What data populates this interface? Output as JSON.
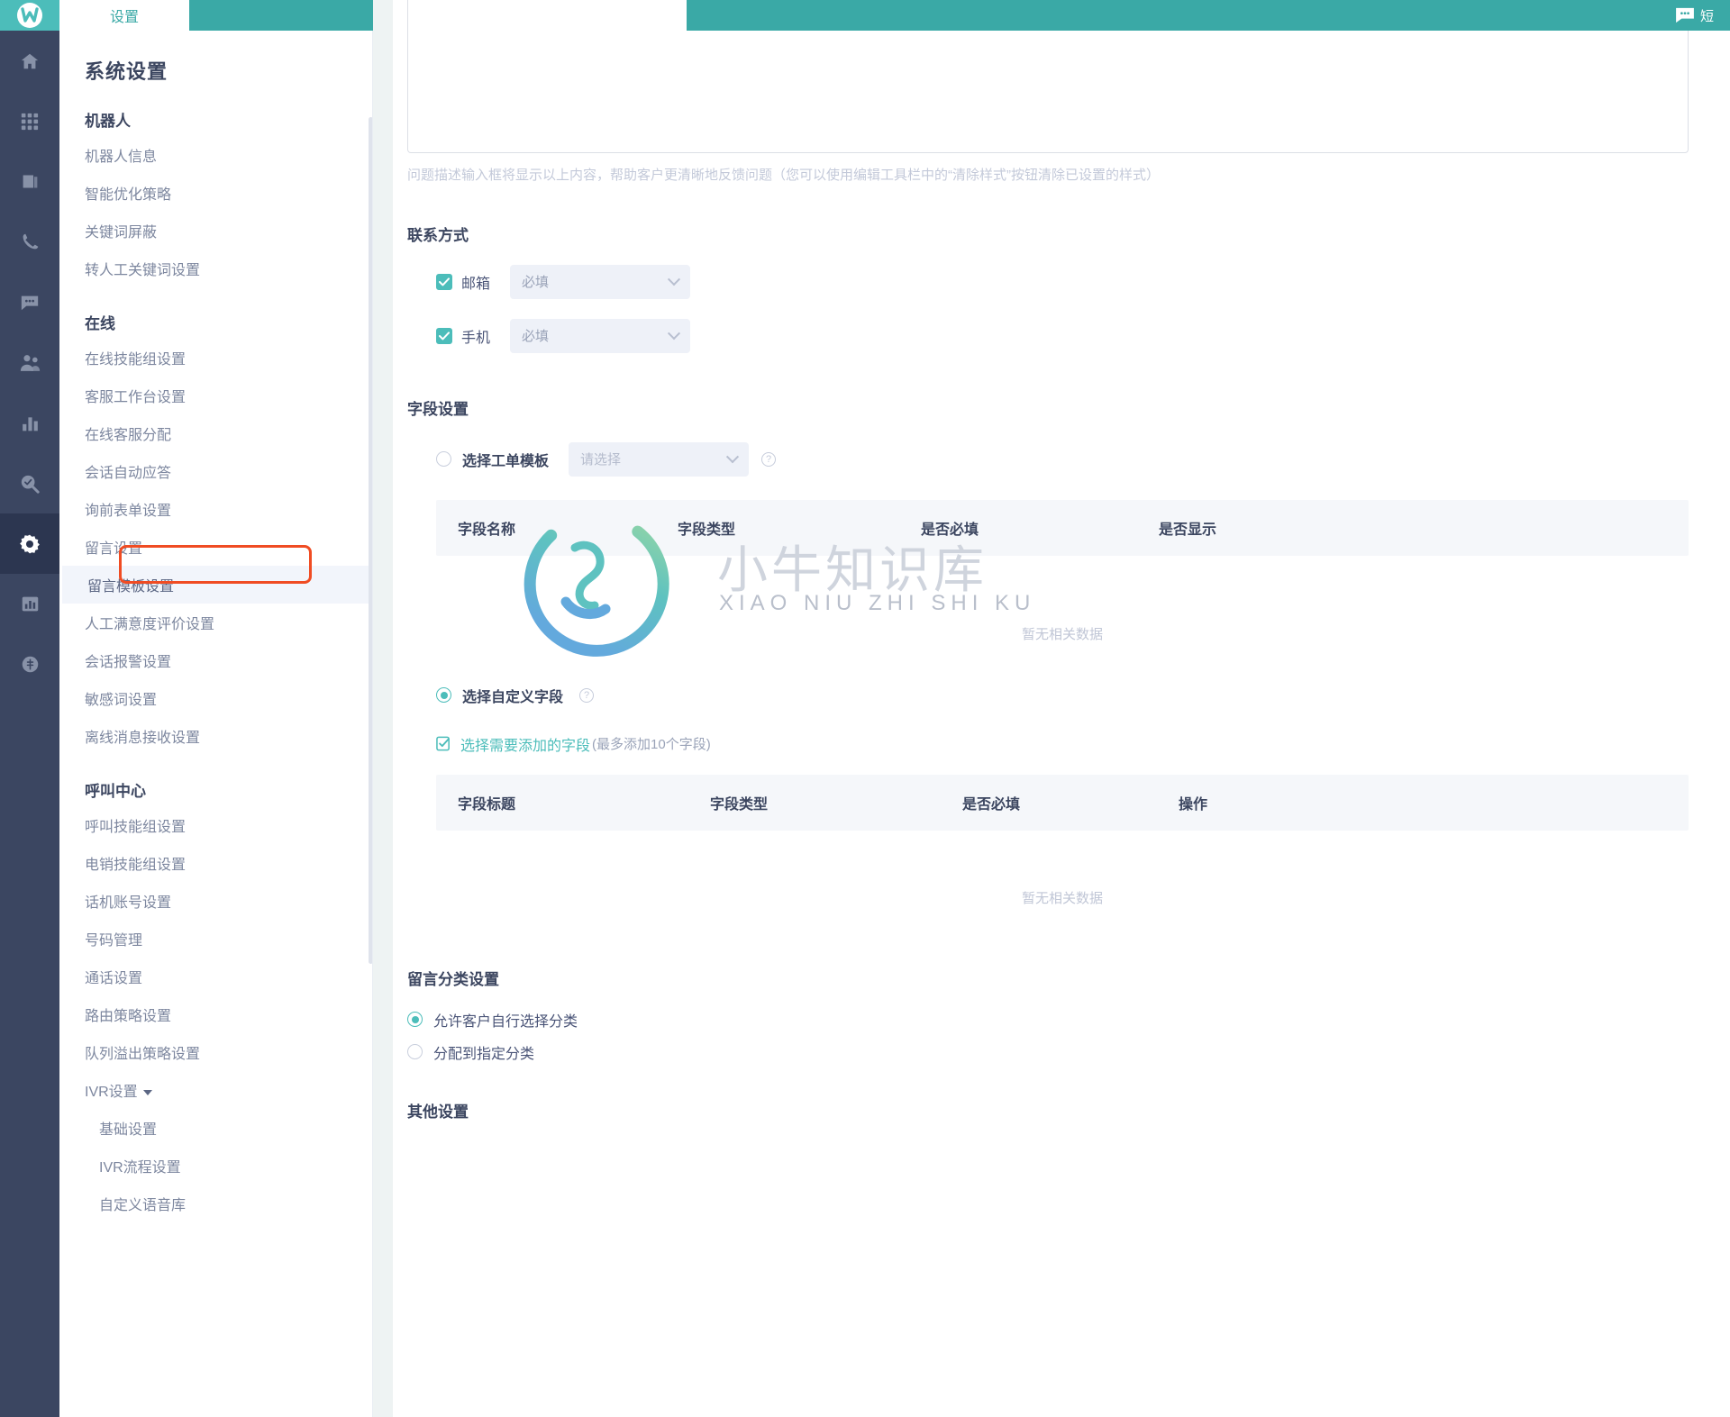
{
  "rail": {
    "logo_name": "brand-logo",
    "items": [
      {
        "name": "home-icon",
        "active": false
      },
      {
        "name": "apps-grid-icon",
        "active": false
      },
      {
        "name": "book-icon",
        "active": false
      },
      {
        "name": "phone-icon",
        "active": false
      },
      {
        "name": "chat-icon",
        "active": false
      },
      {
        "name": "users-icon",
        "active": false
      },
      {
        "name": "bar-chart-icon",
        "active": false
      },
      {
        "name": "search-check-icon",
        "active": false
      },
      {
        "name": "gear-icon",
        "active": true
      },
      {
        "name": "report-icon",
        "active": false
      },
      {
        "name": "coin-icon",
        "active": false
      }
    ]
  },
  "topbar": {
    "tab_label": "设置",
    "message_label": "短"
  },
  "nav": {
    "title": "系统设置",
    "groups": [
      {
        "title": "机器人",
        "items": [
          "机器人信息",
          "智能优化策略",
          "关键词屏蔽",
          "转人工关键词设置"
        ]
      },
      {
        "title": "在线",
        "items": [
          "在线技能组设置",
          "客服工作台设置",
          "在线客服分配",
          "会话自动应答",
          "询前表单设置",
          "留言设置",
          "留言模板设置",
          "人工满意度评价设置",
          "会话报警设置",
          "敏感词设置",
          "离线消息接收设置"
        ],
        "active_item": "留言模板设置"
      },
      {
        "title": "呼叫中心",
        "items": [
          "呼叫技能组设置",
          "电销技能组设置",
          "话机账号设置",
          "号码管理",
          "通话设置",
          "路由策略设置",
          "队列溢出策略设置"
        ],
        "expandable": "IVR设置",
        "sub_items": [
          "基础设置",
          "IVR流程设置",
          "自定义语音库"
        ]
      }
    ]
  },
  "main": {
    "editor_helper": "问题描述输入框将显示以上内容，帮助客户更清晰地反馈问题（您可以使用编辑工具栏中的“清除样式”按钮清除已设置的样式）",
    "contact": {
      "title": "联系方式",
      "rows": [
        {
          "label": "邮箱",
          "checked": true,
          "value": "必填"
        },
        {
          "label": "手机",
          "checked": true,
          "value": "必填"
        }
      ]
    },
    "field_settings": {
      "title": "字段设置",
      "template_option": {
        "label": "选择工单模板",
        "selected": false,
        "select_value": "请选择",
        "help_icon": "question-mark-icon"
      },
      "template_table": {
        "columns": [
          "字段名称",
          "字段类型",
          "是否必填",
          "是否显示"
        ],
        "empty_text": "暂无相关数据",
        "rows": []
      },
      "custom_option": {
        "label": "选择自定义字段",
        "selected": true,
        "help_icon": "question-mark-icon"
      },
      "add_fields": {
        "link": "选择需要添加的字段",
        "hint": "(最多添加10个字段)",
        "icon": "checklist-icon"
      },
      "custom_table": {
        "columns": [
          "字段标题",
          "字段类型",
          "是否必填",
          "操作"
        ],
        "empty_text": "暂无相关数据",
        "rows": []
      }
    },
    "category_settings": {
      "title": "留言分类设置",
      "options": [
        {
          "label": "允许客户自行选择分类",
          "selected": true
        },
        {
          "label": "分配到指定分类",
          "selected": false
        }
      ]
    },
    "other_settings": {
      "title": "其他设置"
    }
  },
  "watermark": {
    "title": "小牛知识库",
    "subtitle": "XIAO NIU ZHI SHI KU"
  },
  "colors": {
    "brand_teal": "#4cbdba",
    "header_teal": "#3aa9a6",
    "rail_dark": "#3b4661",
    "annotation_red": "#f04c23"
  }
}
